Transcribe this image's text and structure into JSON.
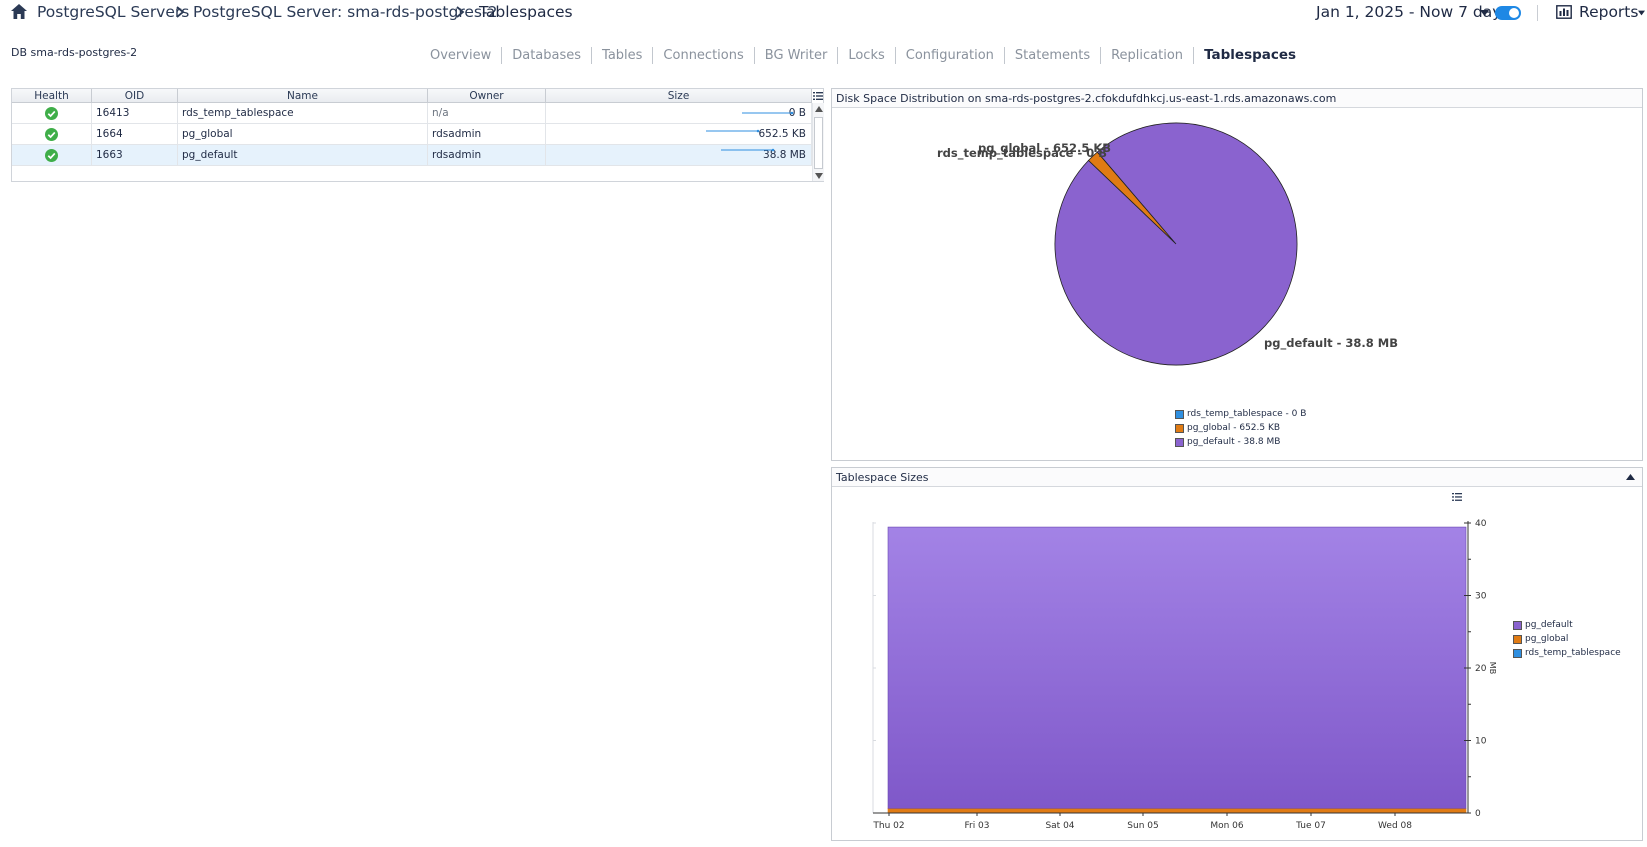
{
  "breadcrumb": {
    "items": [
      "PostgreSQL Servers",
      "PostgreSQL Server: sma-rds-postgres-2",
      "Tablespaces"
    ]
  },
  "header": {
    "date_range": "Jan 1, 2025 - Now 7 days",
    "reports_label": "Reports"
  },
  "db_label": "DB sma-rds-postgres-2",
  "tabs": [
    "Overview",
    "Databases",
    "Tables",
    "Connections",
    "BG Writer",
    "Locks",
    "Configuration",
    "Statements",
    "Replication",
    "Tablespaces"
  ],
  "active_tab": "Tablespaces",
  "table": {
    "columns": [
      "Health",
      "OID",
      "Name",
      "Owner",
      "Size"
    ],
    "rows": [
      {
        "health": "ok",
        "oid": "16413",
        "name": "rds_temp_tablespace",
        "owner": "n/a",
        "size": "0 B"
      },
      {
        "health": "ok",
        "oid": "1664",
        "name": "pg_global",
        "owner": "rdsadmin",
        "size": "652.5 KB"
      },
      {
        "health": "ok",
        "oid": "1663",
        "name": "pg_default",
        "owner": "rdsadmin",
        "size": "38.8 MB"
      }
    ]
  },
  "pie_panel": {
    "title": "Disk Space Distribution on sma-rds-postgres-2.cfokdufdhkcj.us-east-1.rds.amazonaws.com"
  },
  "area_panel": {
    "title": "Tablespace Sizes"
  },
  "colors": {
    "pg_default": "#8a63cf",
    "pg_global": "#e07b14",
    "rds_temp_tablespace": "#2f8fe0",
    "accent": "#1e88e5",
    "health_ok": "#3fae49"
  },
  "chart_data": [
    {
      "type": "pie",
      "title": "Disk Space Distribution on sma-rds-postgres-2.cfokdufdhkcj.us-east-1.rds.amazonaws.com",
      "labels": [
        "rds_temp_tablespace - 0 B",
        "pg_global - 652.5 KB",
        "pg_default - 38.8 MB"
      ],
      "values": [
        0,
        0.6372,
        38.8
      ],
      "units": "MB",
      "legend_position": "bottom-center",
      "legend": [
        "rds_temp_tablespace - 0 B",
        "pg_global - 652.5 KB",
        "pg_default - 38.8 MB"
      ]
    },
    {
      "type": "area",
      "title": "Tablespace Sizes",
      "categories": [
        "Thu 02",
        "Fri 03",
        "Sat 04",
        "Sun 05",
        "Mon 06",
        "Tue 07",
        "Wed 08"
      ],
      "series": [
        {
          "name": "pg_default",
          "values": [
            38.8,
            38.8,
            38.8,
            38.8,
            38.8,
            38.8,
            38.8
          ]
        },
        {
          "name": "pg_global",
          "values": [
            0.64,
            0.64,
            0.64,
            0.64,
            0.64,
            0.64,
            0.64
          ]
        },
        {
          "name": "rds_temp_tablespace",
          "values": [
            0,
            0,
            0,
            0,
            0,
            0,
            0
          ]
        }
      ],
      "stacked": true,
      "ylabel": "MB",
      "ylim": [
        0,
        40
      ],
      "yticks": [
        "0",
        "10",
        "20",
        "30",
        "40"
      ],
      "legend_position": "right",
      "legend": [
        "pg_default",
        "pg_global",
        "rds_temp_tablespace"
      ]
    }
  ]
}
